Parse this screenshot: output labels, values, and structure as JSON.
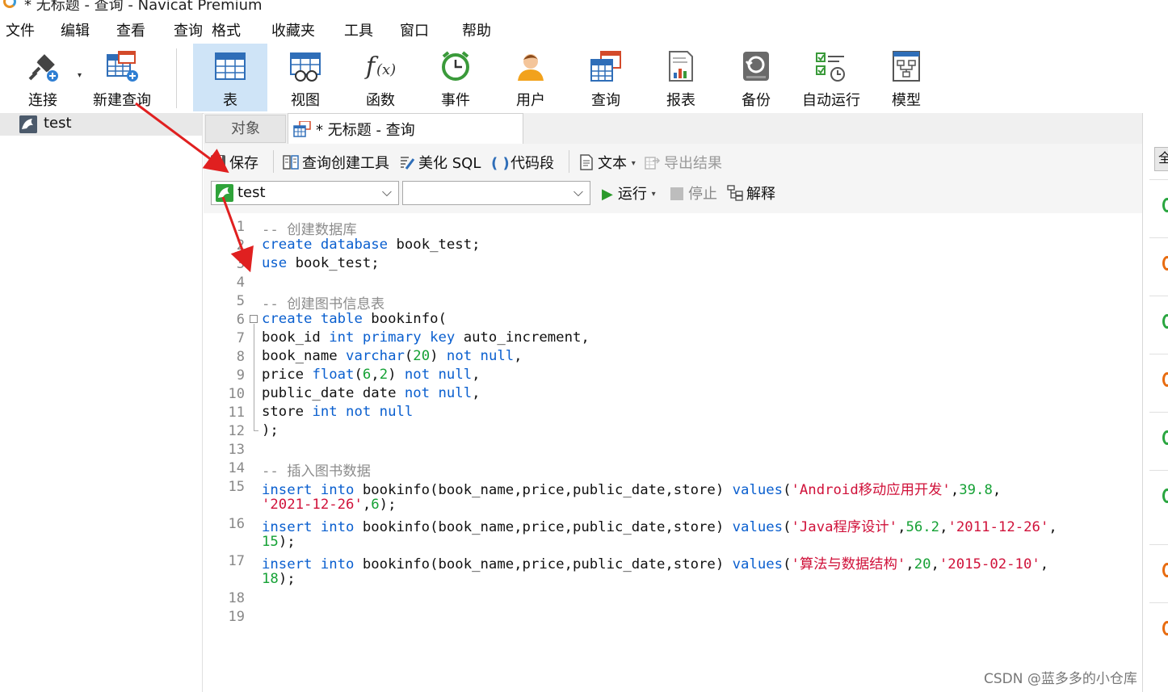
{
  "window": {
    "title": "* 无标题 - 查询 - Navicat Premium"
  },
  "menu": [
    "文件",
    "编辑",
    "查看",
    "查询",
    "格式",
    "收藏夹",
    "工具",
    "窗口",
    "帮助"
  ],
  "toolbar": {
    "connect": "连接",
    "new_query": "新建查询",
    "items": [
      "表",
      "视图",
      "函数",
      "事件",
      "用户",
      "查询",
      "报表",
      "备份",
      "自动运行",
      "模型"
    ]
  },
  "sidebar": {
    "connection": "test"
  },
  "tabs": {
    "objects": "对象",
    "query": "* 无标题 - 查询"
  },
  "query_toolbar": {
    "save": "保存",
    "query_builder": "查询创建工具",
    "beautify": "美化 SQL",
    "snippet": "代码段",
    "text": "文本",
    "export": "导出结果"
  },
  "selectors": {
    "connection": "test",
    "database": ""
  },
  "run_bar": {
    "run": "运行",
    "stop": "停止",
    "explain": "解释"
  },
  "editor": {
    "line_numbers": [
      "1",
      "2",
      "3",
      "4",
      "5",
      "6",
      "7",
      "8",
      "9",
      "10",
      "11",
      "12",
      "13",
      "14",
      "15",
      "16",
      "17",
      "18",
      "19"
    ],
    "c1": "-- 创建数据库",
    "c2": "-- 创建图书信息表",
    "c3": "-- 插入图书数据",
    "s1": "'Android移动应用开发'",
    "s2": "'2021-12-26'",
    "s3": "'Java程序设计'",
    "s4": "'2011-12-26'",
    "s5": "'算法与数据结构'",
    "s6": "'2015-02-10'"
  },
  "right_panel": {
    "button": "全"
  },
  "watermark": "CSDN @蓝多多的小仓库",
  "colors": {
    "keyword": "#0a5fcf",
    "number": "#15a135",
    "string": "#d0123a",
    "comment": "#8c8c8c",
    "arrow": "#e02020",
    "active_tab": "#cfe4f7"
  }
}
